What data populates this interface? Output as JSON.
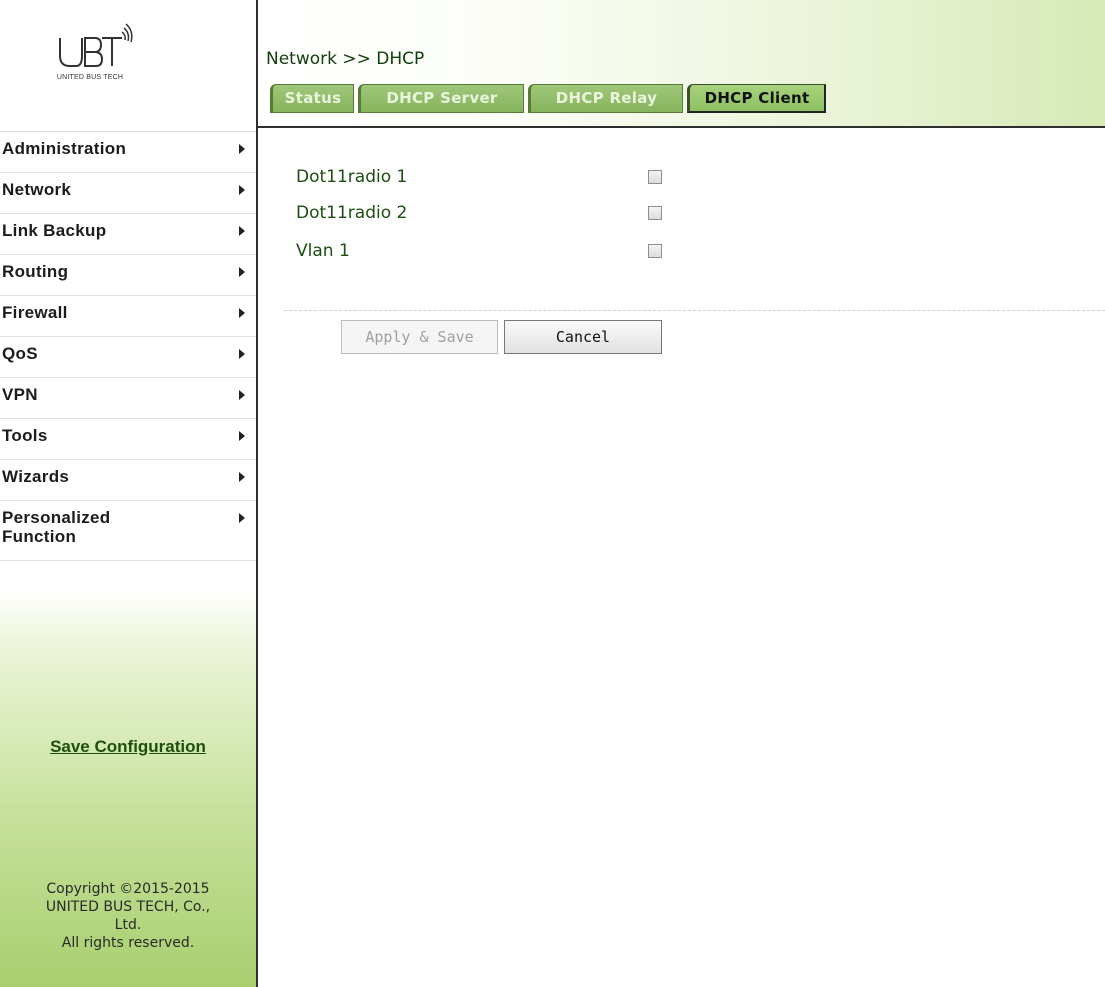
{
  "logo": {
    "brand": "UBT",
    "subtitle": "UNITED BUS TECH"
  },
  "header": {
    "breadcrumb": {
      "section": "Network",
      "separator": ">>",
      "page": "DHCP"
    },
    "tabs": [
      {
        "label": "Status",
        "active": false
      },
      {
        "label": "DHCP Server",
        "active": false
      },
      {
        "label": "DHCP Relay",
        "active": false
      },
      {
        "label": "DHCP Client",
        "active": true
      }
    ]
  },
  "sidebar": {
    "items": [
      {
        "label": "Administration"
      },
      {
        "label": "Network"
      },
      {
        "label": "Link Backup"
      },
      {
        "label": "Routing"
      },
      {
        "label": "Firewall"
      },
      {
        "label": "QoS"
      },
      {
        "label": "VPN"
      },
      {
        "label": "Tools"
      },
      {
        "label": "Wizards"
      },
      {
        "label": "Personalized Function"
      }
    ],
    "save_configuration": "Save Configuration",
    "copyright": {
      "line1": "Copyright ©2015-2015",
      "line2": "UNITED BUS TECH, Co.,",
      "line3": "Ltd.",
      "line4": "All rights reserved."
    }
  },
  "main": {
    "interfaces": [
      {
        "label": "Dot11radio 1",
        "checked": false
      },
      {
        "label": "Dot11radio 2",
        "checked": false
      },
      {
        "label": "Vlan 1",
        "checked": false
      }
    ],
    "buttons": {
      "apply_save": "Apply & Save",
      "cancel": "Cancel"
    }
  },
  "colors": {
    "accent_green": "#8dc060",
    "text_green": "#1b4e10",
    "border_dark": "#2f2f2f"
  }
}
